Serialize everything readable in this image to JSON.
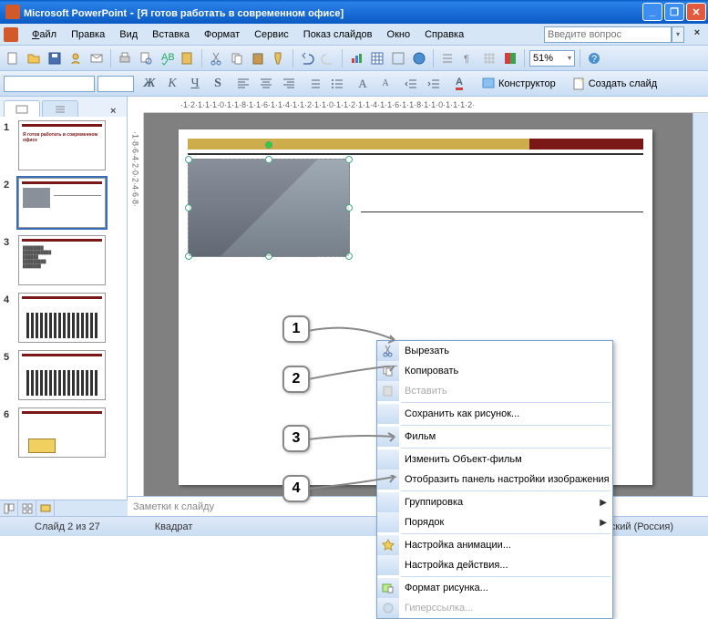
{
  "title_bar": {
    "app_name": "Microsoft PowerPoint",
    "doc_title": "[Я готов работать в современном офисе]"
  },
  "menus": {
    "file": "Файл",
    "edit": "Правка",
    "view": "Вид",
    "insert": "Вставка",
    "format": "Формат",
    "tools": "Сервис",
    "slideshow": "Показ слайдов",
    "window": "Окно",
    "help": "Справка"
  },
  "help_search": {
    "placeholder": "Введите вопрос"
  },
  "toolbar": {
    "zoom": "51%"
  },
  "format_bar": {
    "designer": "Конструктор",
    "new_slide": "Создать слайд"
  },
  "ruler": {
    "h": "·1·2·1·1·1·0·1·1·8·1·1·6·1·1·4·1·1·2·1·1·0·1·1·2·1·1·4·1·1·6·1·1·8·1·1·0·1·1·1·2·",
    "v": "·1·8·6·4·2·0·2·4·6·8·"
  },
  "thumbnails": {
    "items": [
      {
        "num": "1"
      },
      {
        "num": "2"
      },
      {
        "num": "3"
      },
      {
        "num": "4"
      },
      {
        "num": "5"
      },
      {
        "num": "6"
      }
    ]
  },
  "context_menu": {
    "cut": "Вырезать",
    "copy": "Копировать",
    "paste": "Вставить",
    "save_as_picture": "Сохранить как рисунок...",
    "movie": "Фильм",
    "edit_movie_object": "Изменить Объект-фильм",
    "show_picture_toolbar": "Отобразить панель настройки изображения",
    "grouping": "Группировка",
    "order": "Порядок",
    "custom_animation": "Настройка анимации...",
    "action_settings": "Настройка действия...",
    "format_picture": "Формат рисунка...",
    "hyperlink": "Гиперссылка..."
  },
  "callouts": {
    "c1": "1",
    "c2": "2",
    "c3": "3",
    "c4": "4"
  },
  "notes": {
    "placeholder": "Заметки к слайду"
  },
  "status": {
    "slide_of": "Слайд 2 из 27",
    "shape": "Квадрат",
    "lang": "русский (Россия)"
  }
}
